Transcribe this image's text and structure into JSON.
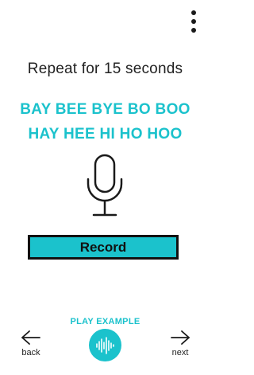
{
  "header": {
    "menu_icon": "more-vertical-icon"
  },
  "main": {
    "instruction": "Repeat for 15 seconds",
    "phrase_lines": [
      "BAY BEE BYE BO BOO",
      "HAY HEE HI HO HOO"
    ],
    "mic_icon": "microphone-icon",
    "record_label": "Record"
  },
  "footer": {
    "play_example_label": "PLAY EXAMPLE",
    "back_label": "back",
    "next_label": "next",
    "play_icon": "waveform-icon",
    "back_icon": "arrow-left-icon",
    "next_icon": "arrow-right-icon"
  },
  "colors": {
    "accent": "#1bc2cc",
    "text": "#222222",
    "border": "#111111",
    "background": "#ffffff"
  }
}
